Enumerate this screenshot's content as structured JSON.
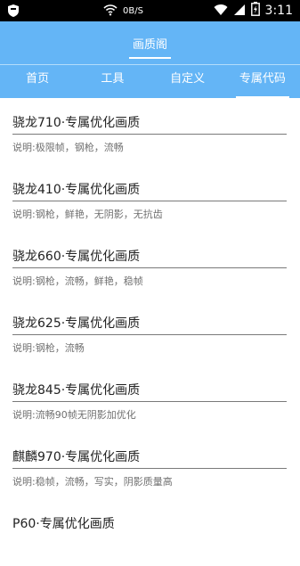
{
  "status_bar": {
    "network_speed": "0B/S",
    "time": "3:11",
    "icons": [
      "app-shield-icon",
      "wifi-icon",
      "signal-icon",
      "battery-charging-icon"
    ]
  },
  "header": {
    "title": "画质阁",
    "background_color": "#64b5f6"
  },
  "tabs": [
    {
      "label": "首页",
      "active": false
    },
    {
      "label": "工具",
      "active": false
    },
    {
      "label": "自定义",
      "active": false
    },
    {
      "label": "专属代码",
      "active": true
    }
  ],
  "items": [
    {
      "title": "骁龙710·专属优化画质",
      "desc": "说明:极限帧，钢枪，流畅"
    },
    {
      "title": "骁龙410·专属优化画质",
      "desc": "说明:钢枪，鲜艳，无阴影，无抗齿"
    },
    {
      "title": "骁龙660·专属优化画质",
      "desc": "说明:钢枪，流畅，鲜艳，稳帧"
    },
    {
      "title": "骁龙625·专属优化画质",
      "desc": "说明:钢枪，流畅"
    },
    {
      "title": "骁龙845·专属优化画质",
      "desc": "说明:流畅90帧无阴影加优化"
    },
    {
      "title": "麒麟970·专属优化画质",
      "desc": "说明:稳帧，流畅，写实，阴影质量高"
    },
    {
      "title": "P60·专属优化画质",
      "desc": ""
    }
  ]
}
